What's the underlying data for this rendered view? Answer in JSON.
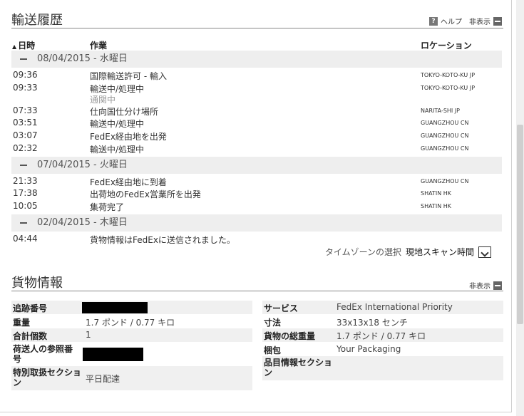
{
  "transport": {
    "title": "輸送履歴",
    "help_label": "ヘルプ",
    "hide_label": "非表示",
    "col_datetime": "日時",
    "col_activity": "作業",
    "col_location": "ロケーション"
  },
  "groups": [
    {
      "date": "08/04/2015 - 水曜日",
      "events": [
        {
          "time": "09:36",
          "activity": "国際輸送許可 - 輸入",
          "location": "TOKYO-KOTO-KU JP"
        },
        {
          "time": "09:33",
          "activity": "輸送中/処理中",
          "location": "TOKYO-KOTO-KU JP",
          "note": "通関中"
        },
        {
          "time": "07:33",
          "activity": "仕向国仕分け場所",
          "location": "NARITA-SHI JP"
        },
        {
          "time": "03:51",
          "activity": "輸送中/処理中",
          "location": "GUANGZHOU CN"
        },
        {
          "time": "03:07",
          "activity": "FedEx経由地を出発",
          "location": "GUANGZHOU CN"
        },
        {
          "time": "02:32",
          "activity": "輸送中/処理中",
          "location": "GUANGZHOU CN"
        }
      ]
    },
    {
      "date": "07/04/2015 - 火曜日",
      "events": [
        {
          "time": "21:33",
          "activity": "FedEx経由地に到着",
          "location": "GUANGZHOU CN"
        },
        {
          "time": "17:38",
          "activity": "出荷地のFedEx営業所を出発",
          "location": "SHATIN HK"
        },
        {
          "time": "10:05",
          "activity": "集荷完了",
          "location": "SHATIN HK"
        }
      ]
    },
    {
      "date": "02/04/2015 - 木曜日",
      "events": [
        {
          "time": "04:44",
          "activity": "貨物情報はFedExに送信されました。",
          "location": ""
        }
      ]
    }
  ],
  "timezone": {
    "label": "タイムゾーンの選択",
    "value": "現地スキャン時間"
  },
  "shipment": {
    "title": "貨物情報",
    "hide_label": "非表示",
    "left": [
      {
        "key": "追跡番号",
        "value": ""
      },
      {
        "key": "重量",
        "value": "1.7 ポンド / 0.77 キロ"
      },
      {
        "key": "合計個数",
        "value": "1"
      },
      {
        "key": "荷送人の参照番号",
        "value": ""
      },
      {
        "key": "特別取扱セクション",
        "value": "平日配達"
      }
    ],
    "right": [
      {
        "key": "サービス",
        "value": "FedEx International Priority"
      },
      {
        "key": "寸法",
        "value": "33x13x18 センチ"
      },
      {
        "key": "貨物の総重量",
        "value": "1.7 ポンド / 0.77 キロ"
      },
      {
        "key": "梱包",
        "value": "Your Packaging"
      },
      {
        "key": "品目情報セクション",
        "value": ""
      }
    ]
  }
}
